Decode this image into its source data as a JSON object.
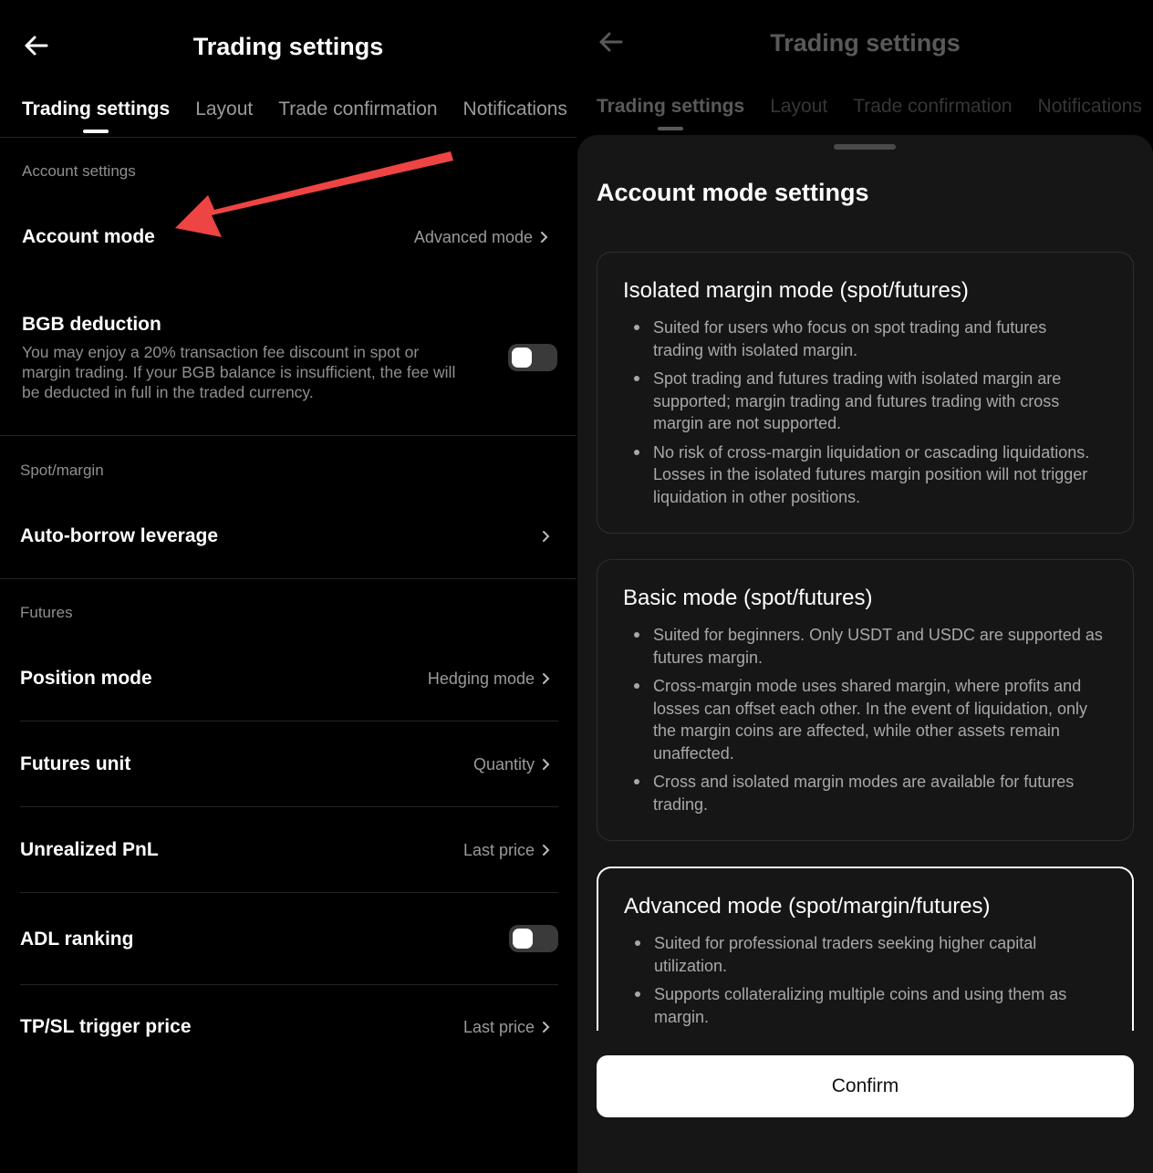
{
  "left": {
    "header": {
      "title": "Trading settings",
      "back_icon": "arrow-left-icon"
    },
    "tabs": [
      {
        "label": "Trading settings",
        "active": true
      },
      {
        "label": "Layout",
        "active": false
      },
      {
        "label": "Trade confirmation",
        "active": false
      },
      {
        "label": "Notifications",
        "active": false
      }
    ],
    "account_settings": {
      "label": "Account settings",
      "account_mode": {
        "title": "Account mode",
        "value": "Advanced mode"
      },
      "bgb_deduction": {
        "title": "BGB deduction",
        "description_lines": [
          "You may enjoy a 20% transaction fee discount in spot or",
          "margin trading. If your BGB balance is insufficient, the fee will",
          "be deducted in full in the traded currency."
        ],
        "enabled": false
      }
    },
    "spot_margin": {
      "label": "Spot/margin",
      "auto_borrow": {
        "title": "Auto-borrow leverage"
      }
    },
    "futures": {
      "label": "Futures",
      "position_mode": {
        "title": "Position mode",
        "value": "Hedging mode"
      },
      "futures_unit": {
        "title": "Futures unit",
        "value": "Quantity"
      },
      "unrealized_pnl": {
        "title": "Unrealized PnL",
        "value": "Last price"
      },
      "adl_ranking": {
        "title": "ADL ranking",
        "enabled": false
      },
      "tpsl_trigger": {
        "title": "TP/SL trigger price",
        "value": "Last price"
      }
    },
    "annotation_arrow_color": "#ef4444"
  },
  "right": {
    "header": {
      "title": "Trading settings"
    },
    "tabs": [
      {
        "label": "Trading settings",
        "active": true
      },
      {
        "label": "Layout",
        "active": false
      },
      {
        "label": "Trade confirmation",
        "active": false
      },
      {
        "label": "Notifications",
        "active": false
      }
    ],
    "sheet": {
      "title": "Account mode settings",
      "cards": [
        {
          "title": "Isolated margin mode (spot/futures)",
          "selected": false,
          "bullets": [
            [
              "Suited for users who focus on spot trading and futures",
              "trading with isolated margin."
            ],
            [
              "Spot trading and futures trading with isolated margin are",
              "supported; margin trading and futures trading with cross",
              "margin are not supported."
            ],
            [
              "No risk of cross-margin liquidation or cascading liquidations.",
              "Losses in the isolated futures margin position will not trigger",
              "liquidation in other positions."
            ]
          ]
        },
        {
          "title": "Basic mode (spot/futures)",
          "selected": false,
          "bullets": [
            [
              "Suited for beginners. Only USDT and USDC are supported as",
              "futures margin."
            ],
            [
              "Cross-margin mode uses shared margin, where profits and",
              "losses can offset each other. In the event of liquidation, only",
              "the margin coins are affected, while other assets remain",
              "unaffected."
            ],
            [
              "Cross and isolated margin modes are available for futures",
              "trading."
            ]
          ]
        },
        {
          "title": "Advanced mode (spot/margin/futures)",
          "selected": true,
          "bullets": [
            [
              "Suited for professional traders seeking higher capital",
              "utilization."
            ],
            [
              "Supports collateralizing multiple coins and using them as",
              "margin."
            ]
          ]
        }
      ],
      "confirm_label": "Confirm"
    }
  }
}
